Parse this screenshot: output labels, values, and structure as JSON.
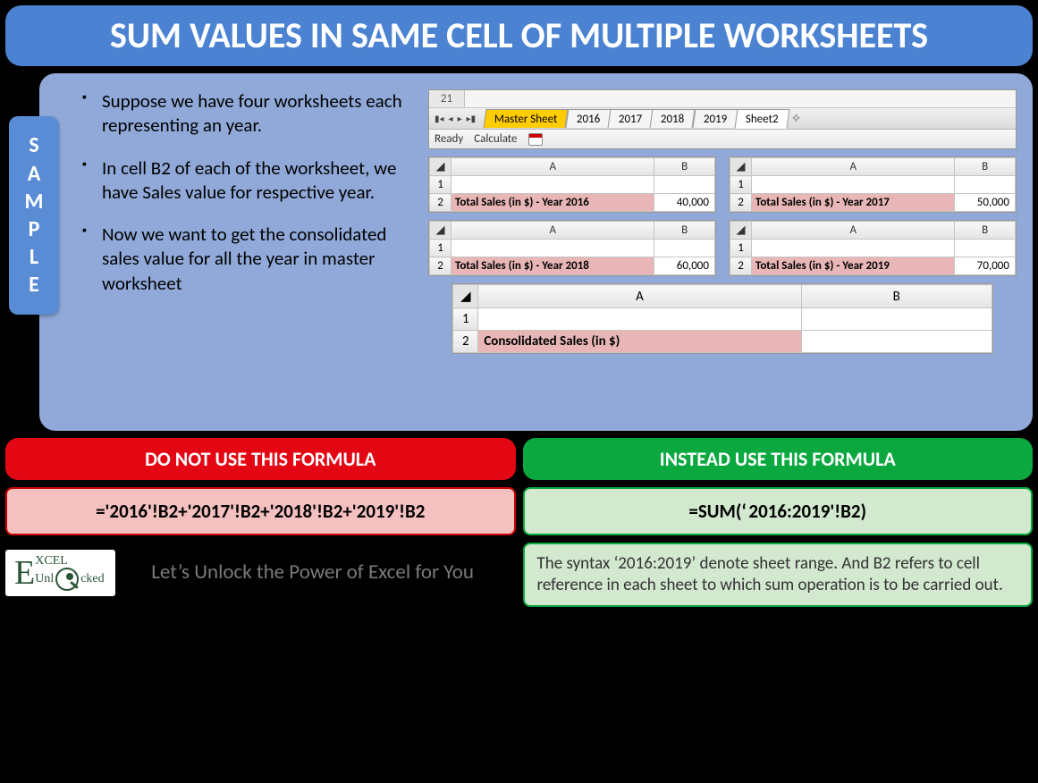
{
  "title": "SUM VALUES IN SAME CELL OF MULTIPLE WORKSHEETS",
  "sample_label": "SAMPLE",
  "bullets": [
    "Suppose we have four worksheets each representing an year.",
    "In cell B2 of each of the worksheet, we have Sales value for respective year.",
    "Now we want to get the consolidated sales value for all the year in master worksheet"
  ],
  "tabstrip": {
    "name_box": "21",
    "tabs": [
      "Master Sheet",
      "2016",
      "2017",
      "2018",
      "2019",
      "Sheet2"
    ],
    "active_tab": "Master Sheet",
    "status": [
      "Ready",
      "Calculate"
    ]
  },
  "mini": [
    {
      "label": "Total Sales (in $) - Year 2016",
      "value": "40,000"
    },
    {
      "label": "Total Sales (in $) - Year 2017",
      "value": "50,000"
    },
    {
      "label": "Total Sales (in $) - Year 2018",
      "value": "60,000"
    },
    {
      "label": "Total Sales (in $) - Year 2019",
      "value": "70,000"
    }
  ],
  "wide": {
    "label": "Consolidated Sales (in $)",
    "value": ""
  },
  "cols": {
    "A": "A",
    "B": "B"
  },
  "rows": {
    "r1": "1",
    "r2": "2"
  },
  "dont": {
    "badge": "DO NOT USE THIS FORMULA",
    "formula": "='2016'!B2+'2017'!B2+'2018'!B2+'2019'!B2"
  },
  "do": {
    "badge": "INSTEAD USE THIS FORMULA",
    "formula": "=SUM(‘ 2016:2019'!B2)",
    "note": "The syntax ‘2016:2019’ denote sheet range. And B2 refers to cell reference in each sheet to which sum operation is to be carried out."
  },
  "logo": {
    "brand_top": "XCEL",
    "brand_bottom": "Unl   cked"
  },
  "tagline": "Let’s Unlock the Power of Excel for You"
}
